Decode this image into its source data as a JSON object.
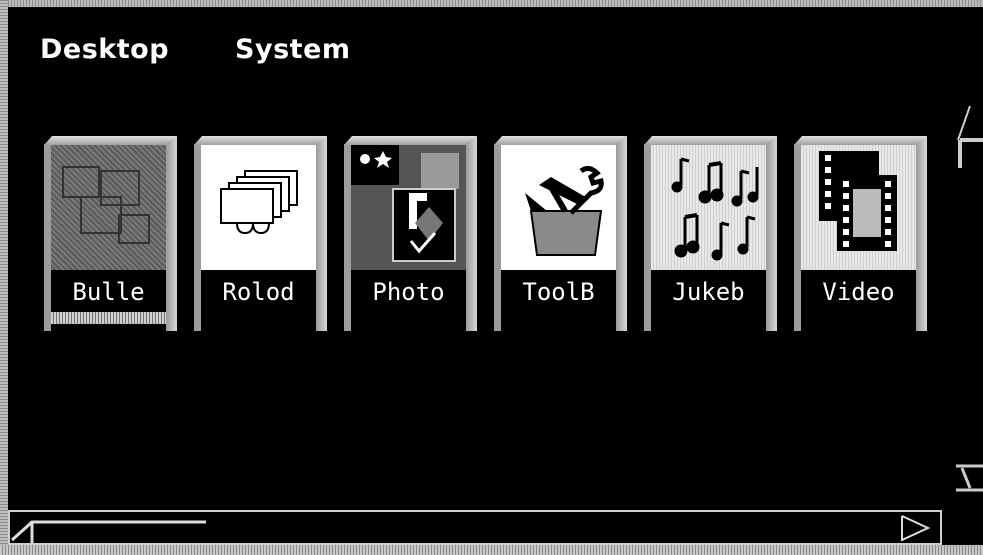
{
  "menubar": {
    "items": [
      "Desktop",
      "System"
    ]
  },
  "icons": [
    {
      "label": "Bulle",
      "icon": "bulletin-board-icon",
      "selected": true
    },
    {
      "label": "Rolod",
      "icon": "rolodex-icon",
      "selected": false
    },
    {
      "label": "Photo",
      "icon": "photo-icon",
      "selected": false
    },
    {
      "label": "ToolB",
      "icon": "toolbox-icon",
      "selected": false
    },
    {
      "label": "Jukeb",
      "icon": "jukebox-icon",
      "selected": false
    },
    {
      "label": "Video",
      "icon": "video-icon",
      "selected": false
    }
  ],
  "colors": {
    "background": "#000000",
    "text": "#ffffff",
    "bevel": "#bdbdbd"
  }
}
